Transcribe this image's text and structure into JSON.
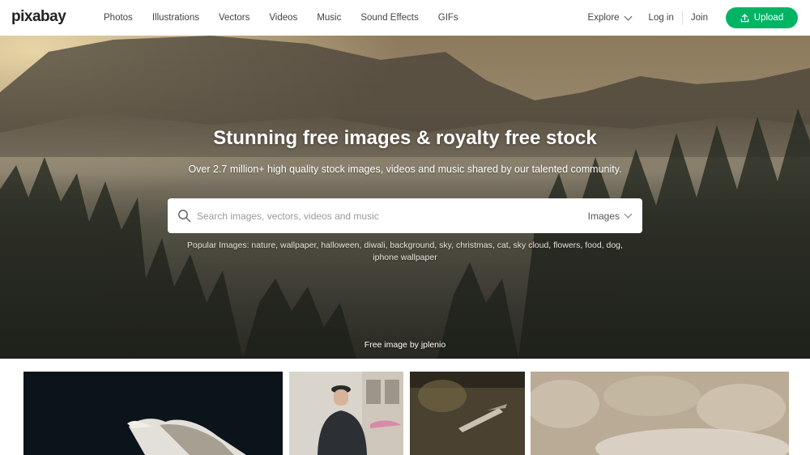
{
  "header": {
    "logo": "pixabay",
    "nav": [
      {
        "label": "Photos"
      },
      {
        "label": "Illustrations"
      },
      {
        "label": "Vectors"
      },
      {
        "label": "Videos"
      },
      {
        "label": "Music"
      },
      {
        "label": "Sound Effects"
      },
      {
        "label": "GIFs"
      }
    ],
    "explore_label": "Explore",
    "login_label": "Log in",
    "join_label": "Join",
    "upload_label": "Upload",
    "brand_color": "#00b464"
  },
  "hero": {
    "title": "Stunning free images & royalty free stock",
    "subtitle": "Over 2.7 million+ high quality stock images, videos and music shared by our talented community.",
    "search": {
      "placeholder": "Search images, vectors, videos and music",
      "value": "",
      "type_selected": "Images"
    },
    "popular": "Popular Images: nature, wallpaper, halloween, diwali, background, sky, christmas, cat, sky cloud, flowers, food, dog, iphone wallpaper",
    "credit": "Free image by jplenio"
  }
}
